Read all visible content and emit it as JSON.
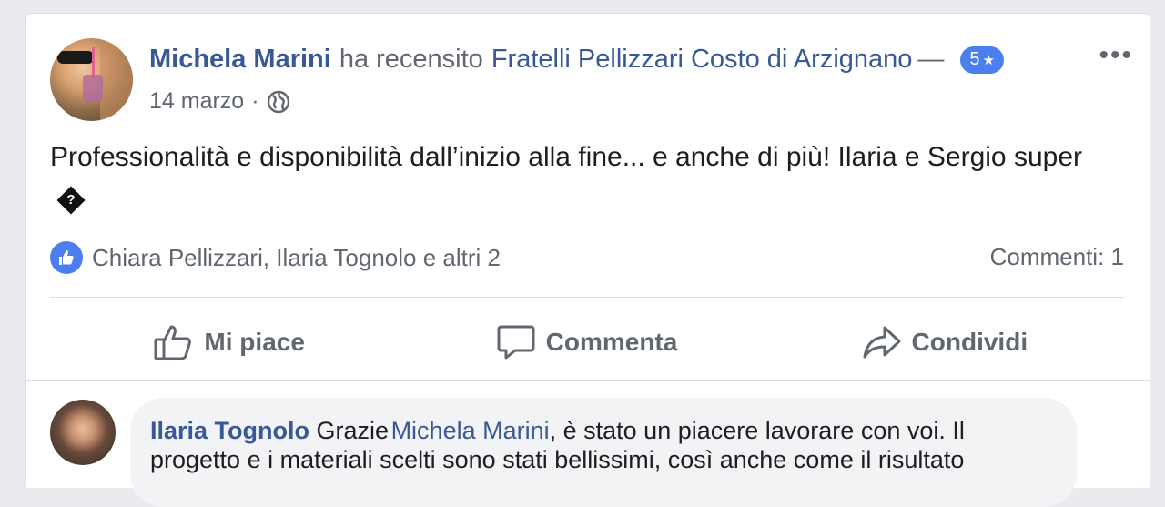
{
  "post": {
    "author": "Michela Marini",
    "action_text": "ha recensito",
    "page_name": "Fratelli Pellizzari Costo di Arzignano",
    "dash": "—",
    "rating": "5",
    "rating_star": "★",
    "date": "14 marzo",
    "meta_sep": "·",
    "text_line": "Professionalità e disponibilità dall’inizio alla fine... e anche di più! Ilaria e Sergio super",
    "emoji_placeholder": "?",
    "more": "•••"
  },
  "reactions": {
    "names": "Chiara Pellizzari, Ilaria Tognolo e altri 2",
    "comments": "Commenti: 1"
  },
  "actions": {
    "like": "Mi piace",
    "comment": "Commenta",
    "share": "Condividi"
  },
  "comment": {
    "author": "Ilaria Tognolo",
    "lead": "Grazie",
    "mention": "Michela Marini",
    "text1": ", è stato un piacere lavorare con voi. Il",
    "text2": "progetto e i materiali scelti sono stati bellissimi, così anche come il risultato"
  },
  "colors": {
    "link": "#385898",
    "badge": "#4b7ff0",
    "muted": "#606770"
  }
}
